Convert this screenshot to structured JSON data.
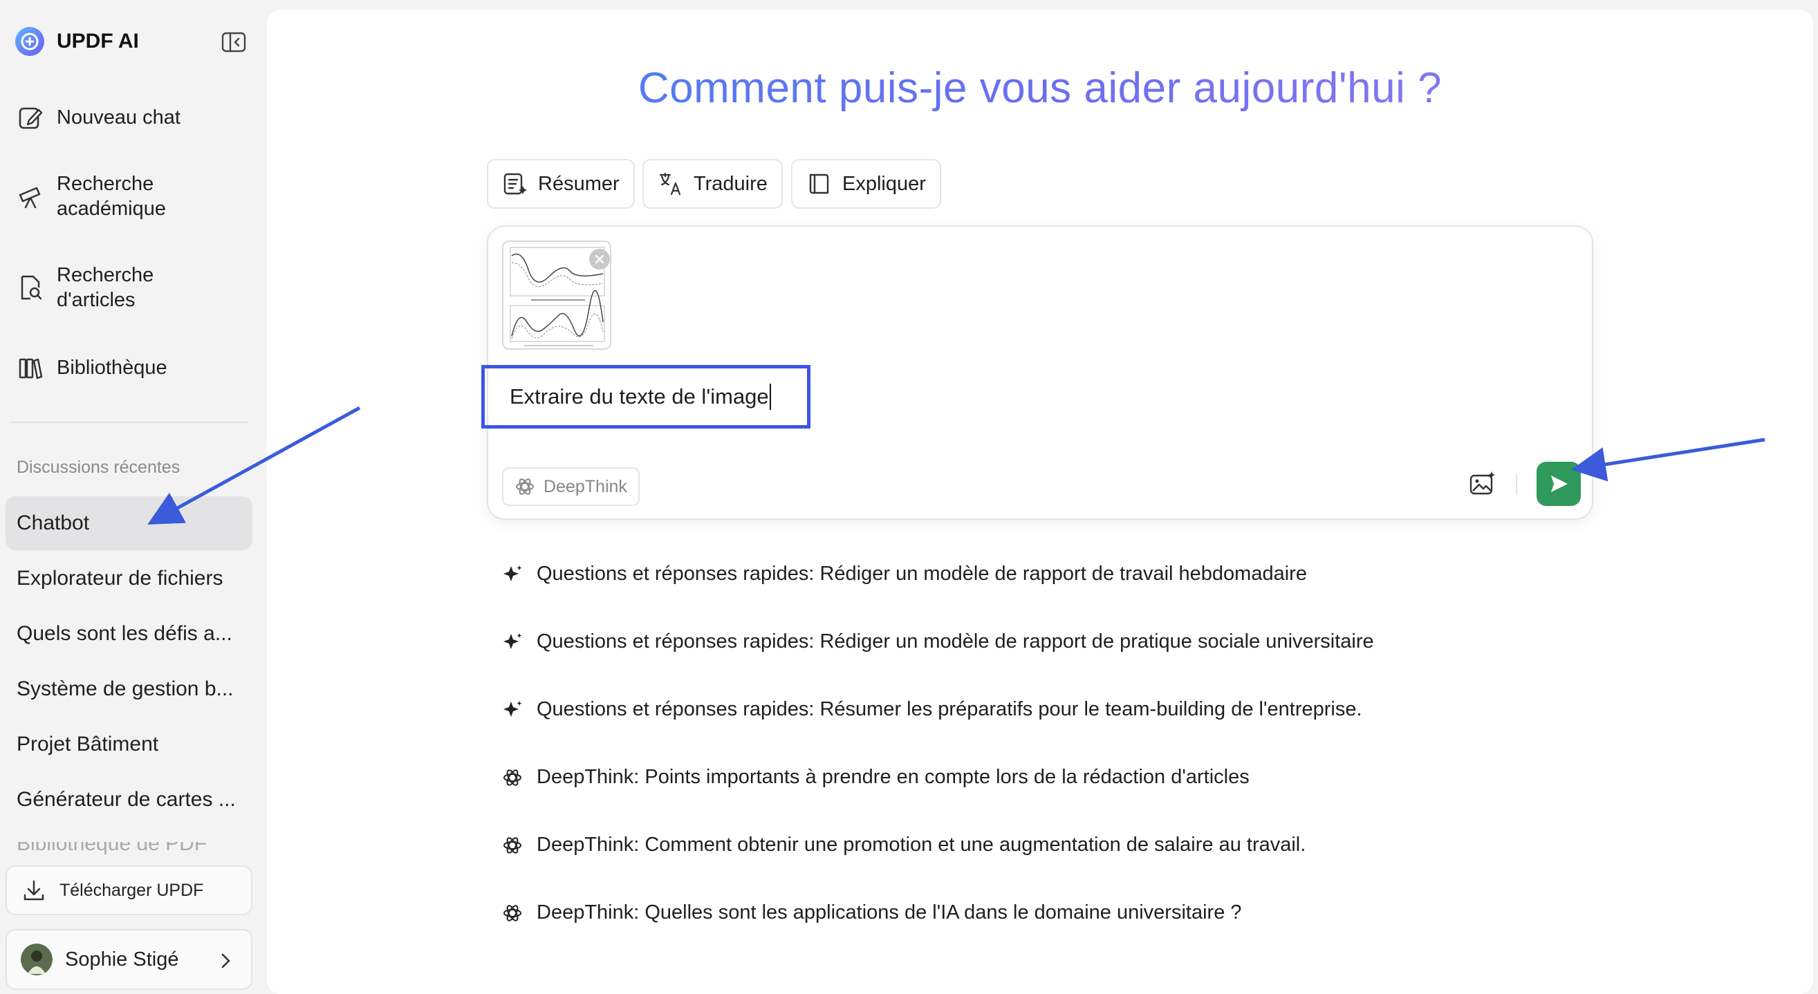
{
  "app": {
    "name": "UPDF AI",
    "accent_color": "#3b55e6",
    "send_color": "#2f9a5b"
  },
  "sidebar": {
    "nav": [
      {
        "label_lines": [
          "Nouveau chat"
        ],
        "icon": "edit-icon"
      },
      {
        "label_lines": [
          "Recherche",
          "académique"
        ],
        "icon": "telescope-icon"
      },
      {
        "label_lines": [
          "Recherche",
          "d'articles"
        ],
        "icon": "document-search-icon"
      },
      {
        "label_lines": [
          "Bibliothèque"
        ],
        "icon": "library-icon"
      }
    ],
    "recent_title": "Discussions récentes",
    "recent": [
      "Chatbot",
      "Explorateur de fichiers",
      "Quels sont les défis a...",
      "Système de gestion b...",
      "Projet Bâtiment",
      "Générateur de cartes ...",
      "Bibliothèque de PDF"
    ],
    "download_label": "Télécharger UPDF",
    "user_name": "Sophie Stigé"
  },
  "main": {
    "headline": "Comment puis-je vous aider aujourd'hui ?",
    "quick_actions": [
      {
        "label": "Résumer",
        "icon": "summarize-icon"
      },
      {
        "label": "Traduire",
        "icon": "translate-icon"
      },
      {
        "label": "Expliquer",
        "icon": "book-icon"
      }
    ],
    "composer": {
      "input_value": "Extraire du texte de l'image",
      "deepthink_label": "DeepThink",
      "attachment_icon": "chart-thumbnail"
    },
    "suggestions": [
      {
        "icon": "sparkle-icon",
        "text": "Questions et réponses rapides: Rédiger un modèle de rapport de travail hebdomadaire"
      },
      {
        "icon": "sparkle-icon",
        "text": "Questions et réponses rapides: Rédiger un modèle de rapport de pratique sociale universitaire"
      },
      {
        "icon": "sparkle-icon",
        "text": "Questions et réponses rapides: Résumer les préparatifs pour le team-building de l'entreprise."
      },
      {
        "icon": "atom-icon",
        "text": "DeepThink: Points importants à prendre en compte lors de la rédaction d'articles"
      },
      {
        "icon": "atom-icon",
        "text": "DeepThink: Comment obtenir une promotion et une augmentation de salaire au travail."
      },
      {
        "icon": "atom-icon",
        "text": "DeepThink: Quelles sont les applications de l'IA dans le domaine universitaire ?"
      }
    ]
  }
}
